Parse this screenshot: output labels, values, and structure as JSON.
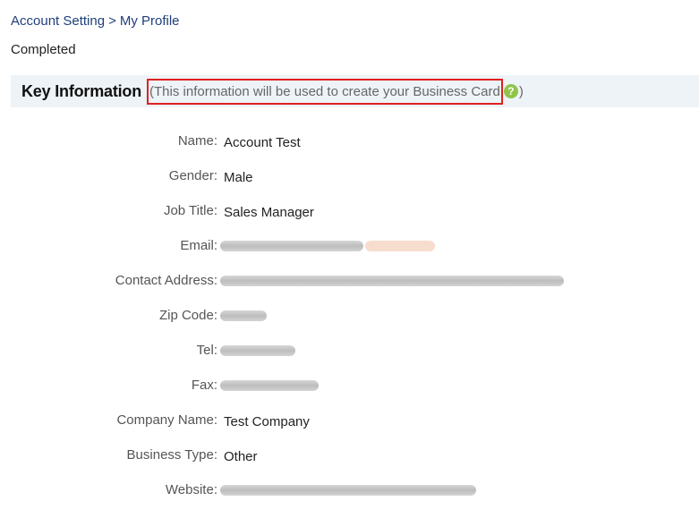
{
  "breadcrumb": {
    "root": "Account Setting",
    "separator": ">",
    "current": "My Profile"
  },
  "status": "Completed",
  "section": {
    "title": "Key Information",
    "open_paren": "(",
    "note": "This information will be used to create your Business Card",
    "close_paren": ")",
    "help_icon": "question-circle-icon"
  },
  "fields": [
    {
      "label": "Name:",
      "value": "Account Test"
    },
    {
      "label": "Gender:",
      "value": "Male"
    },
    {
      "label": "Job Title:",
      "value": "Sales Manager"
    },
    {
      "label": "Email:",
      "value": "",
      "redacted": true
    },
    {
      "label": "Contact Address:",
      "value": "",
      "redacted": true
    },
    {
      "label": "Zip Code:",
      "value": "",
      "redacted": true
    },
    {
      "label": "Tel:",
      "value": "",
      "redacted": true
    },
    {
      "label": "Fax:",
      "value": "",
      "redacted": true
    },
    {
      "label": "Company Name:",
      "value": "Test Company"
    },
    {
      "label": "Business Type:",
      "value": "Other"
    },
    {
      "label": "Website:",
      "value": "",
      "redacted": true
    }
  ],
  "colors": {
    "breadcrumb": "#1f3f7a",
    "header_bg": "#eef3f8",
    "highlight_box": "#e02020",
    "help_icon": "#8fc44a",
    "unconfirmed": "#e8733a"
  }
}
